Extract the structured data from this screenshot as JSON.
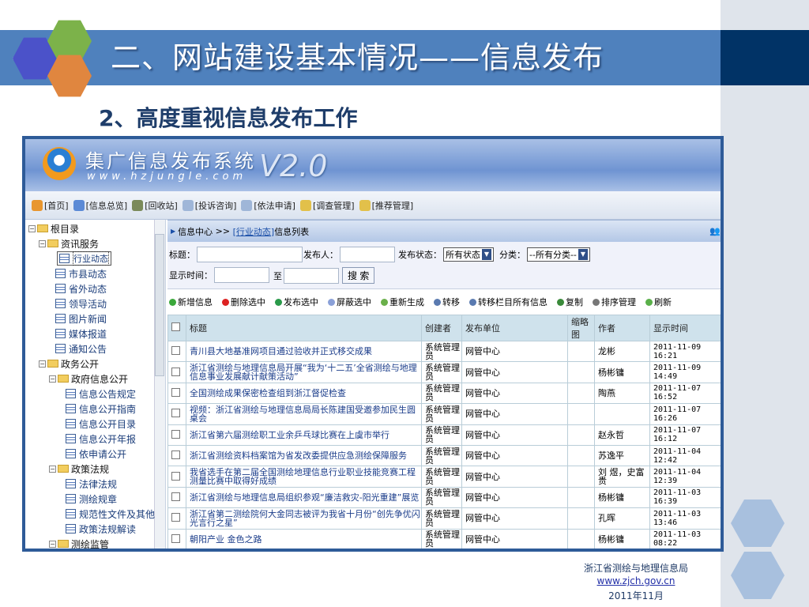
{
  "slide": {
    "title": "二、网站建设基本情况——信息发布",
    "subtitle": "2、高度重视信息发布工作",
    "footer": {
      "org": "浙江省测绘与地理信息局",
      "url": "www.zjch.gov.cn",
      "date": "2011年11月"
    },
    "colors": {
      "title_bar": "#4f81bd",
      "title_bar_dark": "#013366",
      "hex_blue": "#4b52c9",
      "hex_green": "#7cb24a",
      "hex_orange": "#e0863f"
    }
  },
  "app": {
    "name": "集广信息发布系统",
    "url": "www.hzjungle.com",
    "version": "V2.0",
    "toolbar": [
      "[首页]",
      "[信息总览]",
      "[回收站]",
      "[投诉咨询]",
      "[依法申请]",
      "[调查管理]",
      "[推荐管理]"
    ],
    "tree": [
      {
        "label": "根目录",
        "level": 0,
        "type": "folder"
      },
      {
        "label": "资讯服务",
        "level": 1,
        "type": "folder"
      },
      {
        "label": "行业动态",
        "level": 2,
        "type": "leaf",
        "selected": true
      },
      {
        "label": "市县动态",
        "level": 2,
        "type": "leaf"
      },
      {
        "label": "省外动态",
        "level": 2,
        "type": "leaf"
      },
      {
        "label": "领导活动",
        "level": 2,
        "type": "leaf"
      },
      {
        "label": "图片新闻",
        "level": 2,
        "type": "leaf"
      },
      {
        "label": "媒体报道",
        "level": 2,
        "type": "leaf"
      },
      {
        "label": "通知公告",
        "level": 2,
        "type": "leaf"
      },
      {
        "label": "政务公开",
        "level": 1,
        "type": "folder"
      },
      {
        "label": "政府信息公开",
        "level": 2,
        "type": "folder"
      },
      {
        "label": "信息公告规定",
        "level": 3,
        "type": "leaf"
      },
      {
        "label": "信息公开指南",
        "level": 3,
        "type": "leaf"
      },
      {
        "label": "信息公开目录",
        "level": 3,
        "type": "leaf"
      },
      {
        "label": "信息公开年报",
        "level": 3,
        "type": "leaf"
      },
      {
        "label": "依申请公开",
        "level": 3,
        "type": "leaf"
      },
      {
        "label": "政策法规",
        "level": 2,
        "type": "folder"
      },
      {
        "label": "法律法规",
        "level": 3,
        "type": "leaf"
      },
      {
        "label": "测绘规章",
        "level": 3,
        "type": "leaf"
      },
      {
        "label": "规范性文件及其他",
        "level": 3,
        "type": "leaf"
      },
      {
        "label": "政策法规解读",
        "level": 3,
        "type": "leaf"
      },
      {
        "label": "测绘监管",
        "level": 2,
        "type": "folder"
      }
    ],
    "breadcrumb": {
      "root": "信息中心",
      "sep": ">>",
      "current": "[行业动态]",
      "suffix": "信息列表"
    },
    "search": {
      "title_label": "标题：",
      "title_value": "",
      "publisher_label": "发布人：",
      "publisher_value": "",
      "status_label": "发布状态：",
      "status_value": "所有状态",
      "category_label": "分类：",
      "category_value": "--所有分类--",
      "time_label": "显示时间：",
      "to_label": "至",
      "search_button": "搜 索"
    },
    "actions": [
      "新增信息",
      "删除选中",
      "发布选中",
      "屏蔽选中",
      "重新生成",
      "转移",
      "转移栏目所有信息",
      "复制",
      "排序管理",
      "刷新"
    ],
    "table": {
      "headers": [
        "标题",
        "创建者",
        "发布单位",
        "缩略图",
        "作者",
        "显示时间"
      ],
      "rows": [
        {
          "title": "青川县大地基准网项目通过验收并正式移交成果",
          "creator": "系统管理员",
          "unit": "网管中心",
          "author": "龙彬",
          "time": "2011-11-09 16:21"
        },
        {
          "title": "浙江省测绘与地理信息局开展“我为‘十二五’全省测绘与地理信息事业发展献计献策活动”",
          "creator": "系统管理员",
          "unit": "网管中心",
          "author": "杨彬镛",
          "time": "2011-11-09 14:49"
        },
        {
          "title": "全国测绘成果保密检查组到浙江督促检查",
          "creator": "系统管理员",
          "unit": "网管中心",
          "author": "陶燕",
          "time": "2011-11-07 16:52"
        },
        {
          "title": "视频：浙江省测绘与地理信息局局长陈建国受邀参加民生圆桌会",
          "creator": "系统管理员",
          "unit": "网管中心",
          "author": "",
          "time": "2011-11-07 16:26"
        },
        {
          "title": "浙江省第六届测绘职工业余乒乓球比赛在上虞市举行",
          "creator": "系统管理员",
          "unit": "网管中心",
          "author": "赵永哲",
          "time": "2011-11-07 16:12"
        },
        {
          "title": "浙江省测绘资料档案馆为省发改委提供应急测绘保障服务",
          "creator": "系统管理员",
          "unit": "网管中心",
          "author": "苏逸平",
          "time": "2011-11-04 12:42"
        },
        {
          "title": "我省选手在第二届全国测绘地理信息行业职业技能竞赛工程测量比赛中取得好成绩",
          "creator": "系统管理员",
          "unit": "网管中心",
          "author": "刘 煜，史富贵",
          "time": "2011-11-04 12:39"
        },
        {
          "title": "浙江省测绘与地理信息局组织参观“廉洁救灾-阳光重建”展览",
          "creator": "系统管理员",
          "unit": "网管中心",
          "author": "杨彬镛",
          "time": "2011-11-03 16:39"
        },
        {
          "title": "浙江省第二测绘院何大金同志被评为我省十月份“创先争优闪光言行之星”",
          "creator": "系统管理员",
          "unit": "网管中心",
          "author": "孔晖",
          "time": "2011-11-03 13:46"
        },
        {
          "title": "朝阳产业 金色之路",
          "creator": "系统管理员",
          "unit": "网管中心",
          "author": "杨彬镛",
          "time": "2011-11-03 08:22"
        }
      ]
    }
  }
}
